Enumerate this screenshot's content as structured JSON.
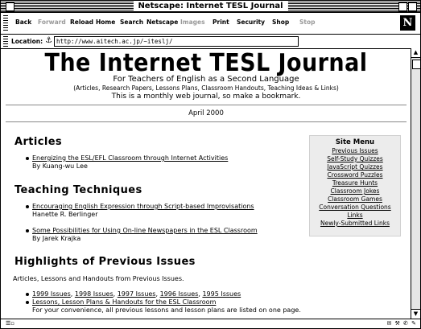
{
  "window": {
    "title": "Netscape: Internet TESL Journal"
  },
  "toolbar": {
    "back": "Back",
    "forward": "Forward",
    "reload": "Reload",
    "home": "Home",
    "search": "Search",
    "netscape": "Netscape",
    "images": "Images",
    "print": "Print",
    "security": "Security",
    "shop": "Shop",
    "stop": "Stop",
    "logo": "N"
  },
  "location": {
    "label": "Location:",
    "url": "http://www.aitech.ac.jp/~iteslj/"
  },
  "masthead": {
    "title": "The Internet TESL Journal",
    "subtitle": "For Teachers of English as a Second Language",
    "tagline": "(Articles, Research Papers, Lessons Plans, Classroom Handouts, Teaching Ideas & Links)",
    "note": "This is a monthly web journal, so make a bookmark.",
    "date": "April 2000"
  },
  "articles": {
    "heading": "Articles",
    "items": [
      {
        "title": "Energizing the ESL/EFL Classroom through Internet Activities",
        "author": "By Kuang-wu Lee"
      }
    ]
  },
  "teaching": {
    "heading": "Teaching Techniques",
    "items": [
      {
        "title": "Encouraging English Expression through Script-based Improvisations",
        "author": "Hanette R. Berlinger"
      },
      {
        "title": "Some Possibilities for Using On-line Newspapers in the ESL Classroom",
        "author": "By Jarek Krajka"
      }
    ]
  },
  "highlights": {
    "heading": "Highlights of Previous Issues",
    "intro": "Articles, Lessons and Handouts from Previous Issues.",
    "years": [
      "1999 Issues",
      "1998 Issues",
      "1997 Issues",
      "1996 Issues",
      "1995 Issues"
    ],
    "lessons_link": "Lessons, Lesson Plans & Handouts for the ESL Classroom",
    "lessons_note": "For your convenience, all previous lessons and lesson plans are listed on one page."
  },
  "sitemenu": {
    "heading": "Site Menu",
    "items": [
      "Previous Issues",
      "Self-Study Quizzes",
      "JavaScript Quizzes",
      "Crossword Puzzles",
      "Treasure Hunts",
      "Classroom Jokes",
      "Classroom Games",
      "Conversation Questions",
      "Links",
      "Newly-Submitted Links"
    ]
  }
}
